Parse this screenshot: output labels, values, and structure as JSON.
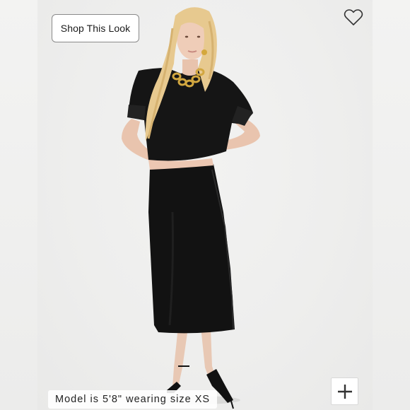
{
  "buttons": {
    "shop_this_look": "Shop This Look"
  },
  "caption": {
    "model_info": "Model is 5'8\" wearing size XS"
  },
  "icons": {
    "favorite": "heart-outline-icon",
    "zoom": "plus-icon"
  },
  "colors": {
    "background": "#f0f0ef",
    "garment": "#111111",
    "button_border": "#8a8a8a"
  }
}
